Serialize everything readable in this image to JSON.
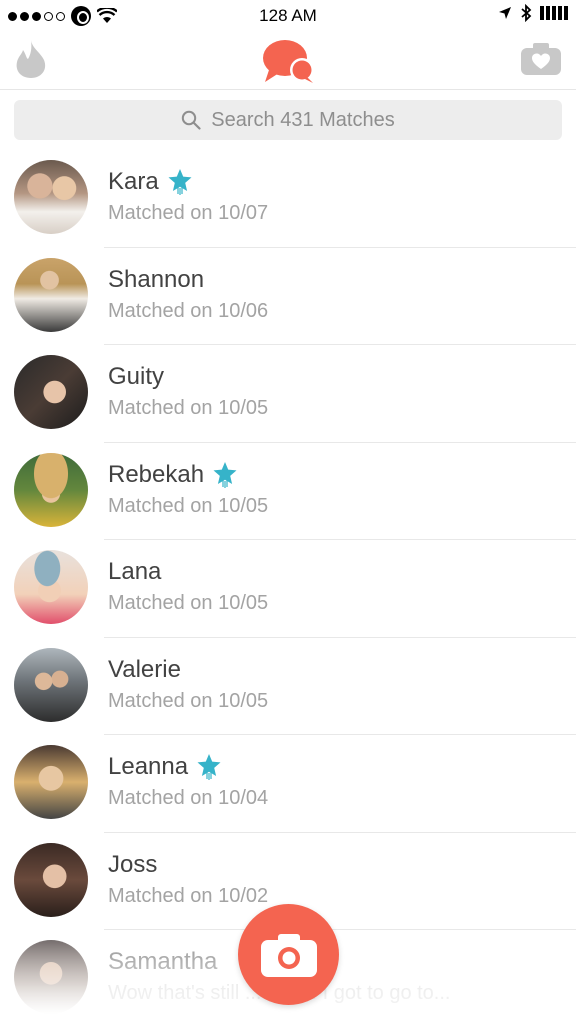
{
  "status_bar": {
    "time": "128 AM"
  },
  "header": {
    "left_icon": "flame-icon",
    "center_icon": "chat-bubbles-icon",
    "right_icon": "camera-heart-icon",
    "accent_color": "#f46450"
  },
  "search": {
    "placeholder": "Search 431 Matches"
  },
  "matches": [
    {
      "name": "Kara",
      "subtitle": "Matched on 10/07",
      "starred": true
    },
    {
      "name": "Shannon",
      "subtitle": "Matched on 10/06",
      "starred": false
    },
    {
      "name": "Guity",
      "subtitle": "Matched on 10/05",
      "starred": false
    },
    {
      "name": "Rebekah",
      "subtitle": "Matched on 10/05",
      "starred": true
    },
    {
      "name": "Lana",
      "subtitle": "Matched on 10/05",
      "starred": false
    },
    {
      "name": "Valerie",
      "subtitle": "Matched on 10/05",
      "starred": false
    },
    {
      "name": "Leanna",
      "subtitle": "Matched on 10/04",
      "starred": true
    },
    {
      "name": "Joss",
      "subtitle": "Matched on 10/02",
      "starred": false
    },
    {
      "name": "Samantha",
      "subtitle": "Wow that's still ... me!!!! I got to go to...",
      "starred": false
    }
  ],
  "star_color": "#36b3c9",
  "fab": {
    "icon": "camera-icon",
    "color": "#f46450"
  }
}
